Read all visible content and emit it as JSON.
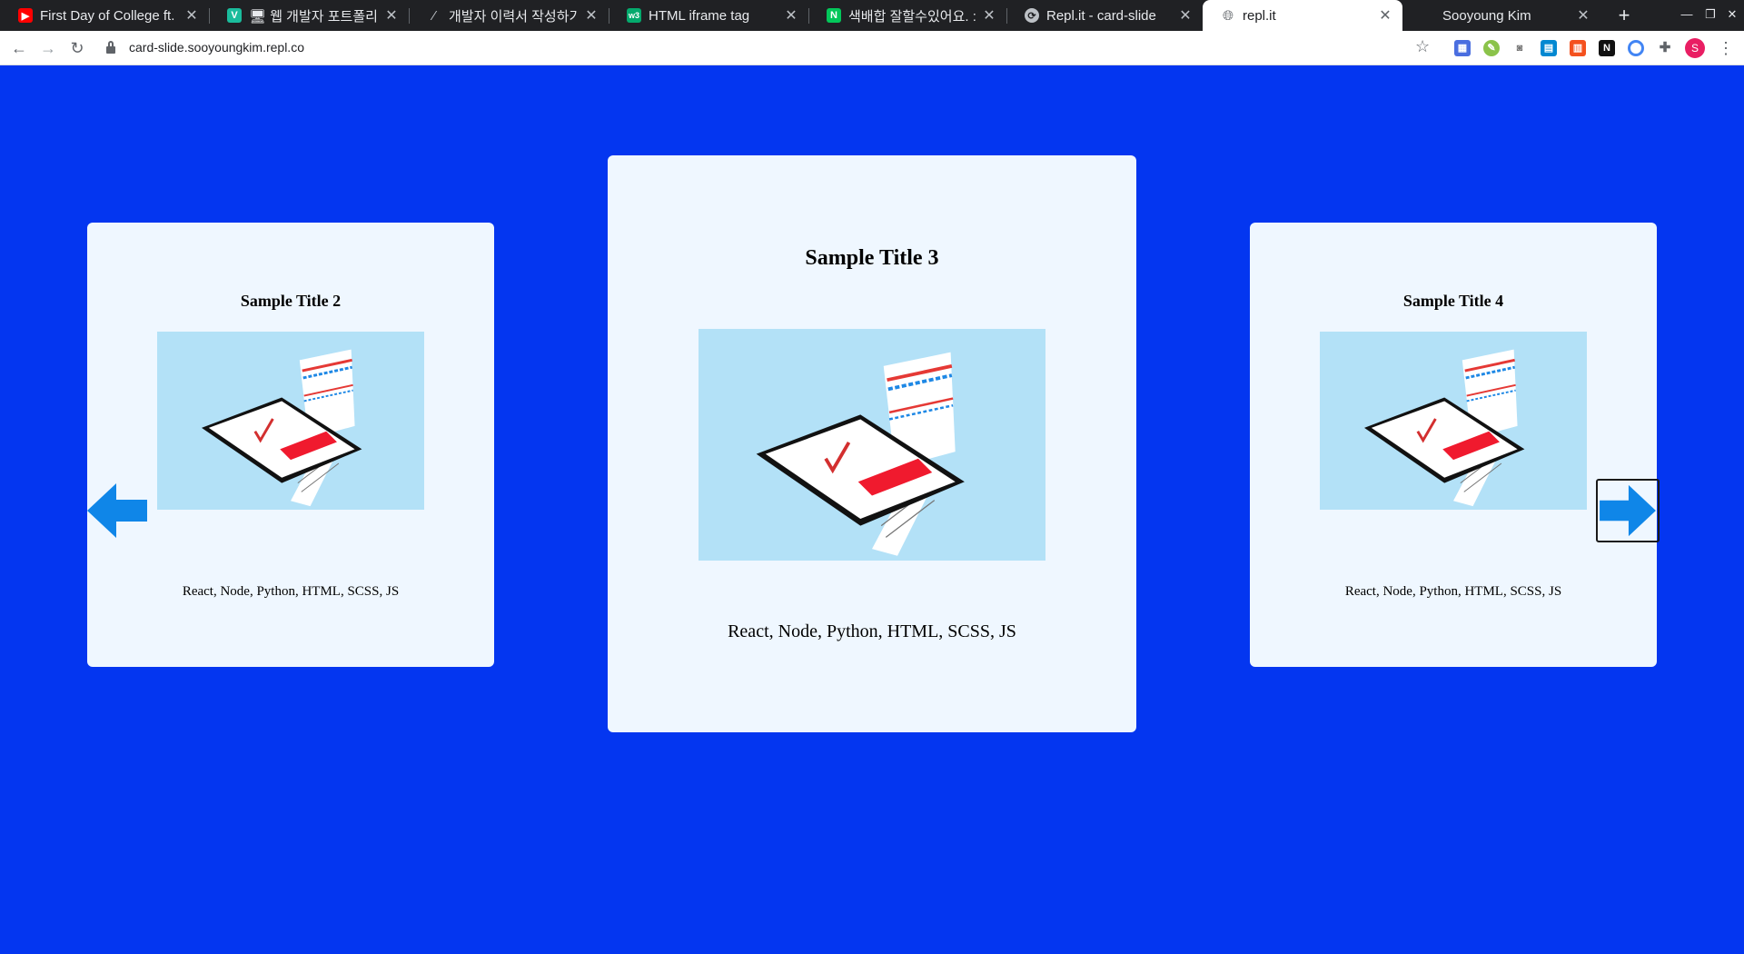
{
  "browser": {
    "tabs": [
      {
        "title": "First Day of College ft.",
        "favicon": "youtube-icon",
        "color": "#ff0000"
      },
      {
        "title": "🖥 웹 개발자 포트폴리오",
        "favicon": "v-icon",
        "color": "#1abc9c"
      },
      {
        "title": "개발자 이력서 작성하기 (",
        "favicon": "slash-icon",
        "color": "#202124"
      },
      {
        "title": "HTML iframe tag",
        "favicon": "w3-icon",
        "color": "#04aa6d"
      },
      {
        "title": "색배합 잘할수있어요. : 네",
        "favicon": "naver-icon",
        "color": "#03c75a"
      },
      {
        "title": "Repl.it - card-slide",
        "favicon": "replit-icon",
        "color": "#bdc1c6"
      },
      {
        "title": "repl.it",
        "favicon": "globe-icon",
        "color": "#5f6368",
        "active": true
      },
      {
        "title": "Sooyoung Kim",
        "favicon": "",
        "color": "#202124"
      }
    ],
    "url": "card-slide.sooyoungkim.repl.co",
    "avatar_letter": "S"
  },
  "cards": [
    {
      "title": "Sample Title 2",
      "tech": "React, Node, Python, HTML, SCSS, JS"
    },
    {
      "title": "Sample Title 3",
      "tech": "React, Node, Python, HTML, SCSS, JS"
    },
    {
      "title": "Sample Title 4",
      "tech": "React, Node, Python, HTML, SCSS, JS"
    }
  ],
  "colors": {
    "page_background": "#0436f0",
    "card_background": "#eff7ff",
    "card_shadow": "#413e46",
    "image_background": "#b3e1f7",
    "arrow": "#0f86e8"
  }
}
